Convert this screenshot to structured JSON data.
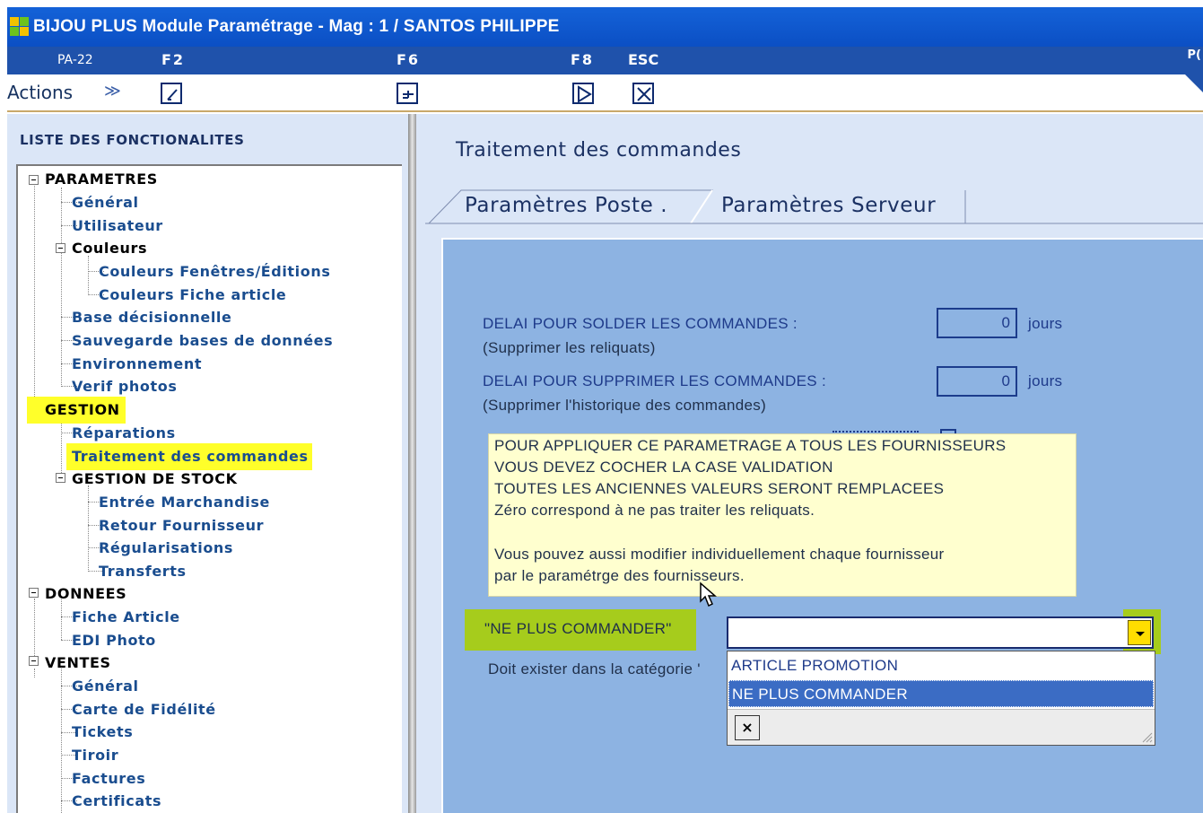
{
  "window": {
    "title": "BIJOU PLUS Module Paramétrage  - Mag : 1 / SANTOS PHILIPPE"
  },
  "fkeys": {
    "code": "PA-22",
    "f2": "F2",
    "f6": "F6",
    "f8": "F8",
    "esc": "ESC",
    "corner": "P("
  },
  "toolbar": {
    "actions_label": "Actions",
    "chevron": "≫"
  },
  "sidebar": {
    "header": "LISTE DES FONCTIONALITES",
    "tree": [
      {
        "label": "PARAMETRES"
      },
      {
        "label": "Général"
      },
      {
        "label": "Utilisateur"
      },
      {
        "label": "Couleurs"
      },
      {
        "label": "Couleurs Fenêtres/Éditions"
      },
      {
        "label": "Couleurs Fiche article"
      },
      {
        "label": "Base décisionnelle"
      },
      {
        "label": "Sauvegarde bases de données"
      },
      {
        "label": "Environnement"
      },
      {
        "label": "Verif photos"
      },
      {
        "label": "GESTION"
      },
      {
        "label": "Réparations"
      },
      {
        "label": "Traitement des commandes"
      },
      {
        "label": "GESTION DE STOCK"
      },
      {
        "label": "Entrée Marchandise"
      },
      {
        "label": "Retour Fournisseur"
      },
      {
        "label": "Régularisations"
      },
      {
        "label": "Transferts"
      },
      {
        "label": "DONNEES"
      },
      {
        "label": "Fiche Article"
      },
      {
        "label": "EDI Photo"
      },
      {
        "label": "VENTES"
      },
      {
        "label": "Général"
      },
      {
        "label": "Carte de Fidélité"
      },
      {
        "label": "Tickets"
      },
      {
        "label": "Tiroir"
      },
      {
        "label": "Factures"
      },
      {
        "label": "Certificats"
      }
    ]
  },
  "main": {
    "title": "Traitement des commandes",
    "tabs": [
      {
        "label": "Paramètres Poste ."
      },
      {
        "label": "Paramètres Serveur"
      }
    ],
    "delai_solder": {
      "label": "DELAI POUR SOLDER LES COMMANDES :",
      "sub": "(Supprimer les reliquats)",
      "value": "0",
      "unit": "jours"
    },
    "delai_supprimer": {
      "label": "DELAI POUR SUPPRIMER LES COMMANDES :",
      "sub": "(Supprimer l'historique des commandes)",
      "value": "0",
      "unit": "jours"
    },
    "info_lines": [
      "POUR APPLIQUER CE PARAMETRAGE A TOUS LES FOURNISSEURS",
      "VOUS DEVEZ COCHER LA CASE VALIDATION",
      "TOUTES LES ANCIENNES VALEURS SERONT REMPLACEES",
      "Zéro correspond à ne pas traiter les reliquats.",
      "Vous pouvez aussi modifier individuellement chaque fournisseur",
      "par le paramétrge des fournisseurs."
    ],
    "npc_label": "\"NE PLUS COMMANDER\"",
    "combo_value": "",
    "exist_label": "Doit exister dans la catégorie '",
    "dropdown": {
      "options": [
        "ARTICLE PROMOTION",
        "NE PLUS COMMANDER"
      ],
      "close": "×"
    }
  },
  "colors": {
    "titlebar": "#0b4fc4",
    "content_bg": "#8db3e2",
    "highlight_yellow": "#ffff2a",
    "highlight_green": "#a6cc1c"
  }
}
